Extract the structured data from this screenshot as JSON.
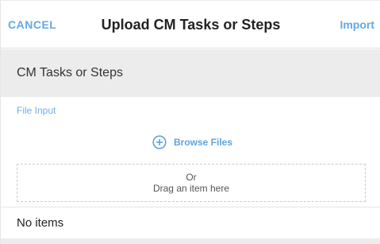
{
  "header": {
    "cancel_label": "CANCEL",
    "title": "Upload CM Tasks or Steps",
    "import_label": "Import"
  },
  "section": {
    "title": "CM Tasks or Steps"
  },
  "file_input": {
    "label": "File Input",
    "browse_label": "Browse Files",
    "browse_icon": "plus-circle-icon",
    "drop_or": "Or",
    "drop_hint": "Drag an item here"
  },
  "list": {
    "empty_text": "No items"
  },
  "colors": {
    "accent": "#64a8e6",
    "section_bg": "#ececec"
  }
}
